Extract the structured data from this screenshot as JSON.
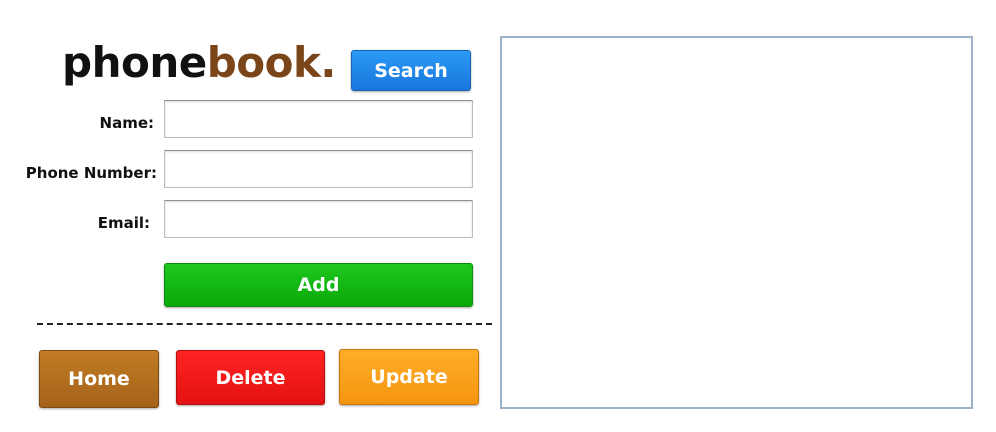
{
  "logo": {
    "part1": "phone",
    "part2": "book."
  },
  "search_button": "Search",
  "form": {
    "name_label": "Name:",
    "name_value": "",
    "phone_label": "Phone Number:",
    "phone_value": "",
    "email_label": "Email:",
    "email_value": ""
  },
  "add_button": "Add",
  "divider_text": "",
  "buttons": {
    "home": "Home",
    "delete": "Delete",
    "update": "Update"
  },
  "colors": {
    "brand_dark": "#111111",
    "brand_accent": "#7a4519",
    "search": "#1876dc",
    "add": "#0aa80a",
    "home": "#a4621a",
    "delete": "#e31212",
    "update": "#f5950f",
    "panel_border": "#9db1c8"
  }
}
